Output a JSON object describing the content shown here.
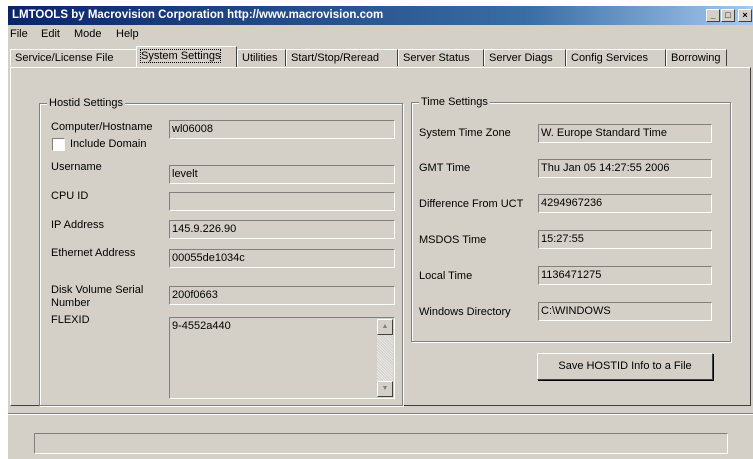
{
  "window": {
    "title": "LMTOOLS by Macrovision Corporation http://www.macrovision.com",
    "controls": {
      "minimize": "_",
      "maximize": "□",
      "close": "×"
    }
  },
  "menu": [
    "File",
    "Edit",
    "Mode",
    "Help"
  ],
  "tabs": [
    {
      "label": "Service/License File",
      "active": false
    },
    {
      "label": "System Settings",
      "active": true
    },
    {
      "label": "Utilities",
      "active": false
    },
    {
      "label": "Start/Stop/Reread",
      "active": false
    },
    {
      "label": "Server Status",
      "active": false
    },
    {
      "label": "Server Diags",
      "active": false
    },
    {
      "label": "Config Services",
      "active": false
    },
    {
      "label": "Borrowing",
      "active": false
    }
  ],
  "hostid": {
    "group_label": "Hostid Settings",
    "computer_hostname": {
      "label": "Computer/Hostname",
      "value": "wl06008"
    },
    "include_domain": {
      "label": "Include Domain",
      "checked": false
    },
    "username": {
      "label": "Username",
      "value": "levelt"
    },
    "cpu_id": {
      "label": "CPU ID",
      "value": ""
    },
    "ip_address": {
      "label": "IP Address",
      "value": "145.9.226.90"
    },
    "ethernet_address": {
      "label": "Ethernet Address",
      "value": "00055de1034c"
    },
    "disk_volume_serial": {
      "label_line1": "Disk Volume Serial",
      "label_line2": "Number",
      "value": "200f0663"
    },
    "flexid": {
      "label": "FLEXID",
      "value": "9-4552a440"
    }
  },
  "time": {
    "group_label": "Time Settings",
    "system_time_zone": {
      "label": "System Time Zone",
      "value": "W. Europe Standard Time"
    },
    "gmt_time": {
      "label": "GMT Time",
      "value": "Thu Jan 05 14:27:55 2006"
    },
    "difference_from_uct": {
      "label": "Difference From UCT",
      "value": "4294967236"
    },
    "msdos_time": {
      "label": "MSDOS Time",
      "value": "15:27:55"
    },
    "local_time": {
      "label": "Local Time",
      "value": "1136471275"
    },
    "windows_directory": {
      "label": "Windows Directory",
      "value": "C:\\WINDOWS"
    }
  },
  "save_button": {
    "label": "Save HOSTID Info to a File"
  },
  "status_bar": {
    "text": ""
  },
  "colors": {
    "face": "#d4d0c8",
    "title_start": "#0a246a",
    "title_end": "#a6caf0"
  }
}
